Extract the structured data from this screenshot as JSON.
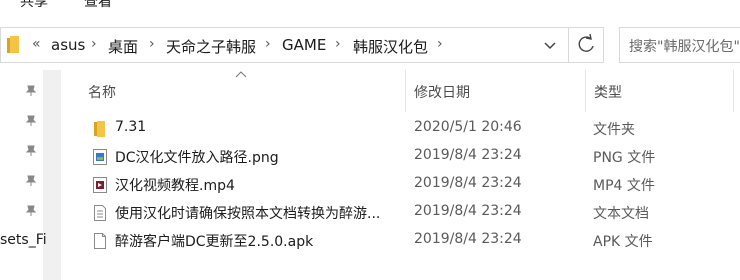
{
  "ribbon": {
    "tabs": [
      "共享",
      "查看"
    ]
  },
  "address": {
    "overflow": "«",
    "crumbs": [
      "asus",
      "桌面",
      "天命之子韩服",
      "GAME",
      "韩服汉化包"
    ],
    "separator": "›"
  },
  "search": {
    "placeholder": "搜索\"韩服汉化包\""
  },
  "navpane": {
    "fragment": "sets_Fi"
  },
  "columns": {
    "name": "名称",
    "date": "修改日期",
    "type": "类型"
  },
  "files": [
    {
      "name": "7.31",
      "date": "2020/5/1 20:46",
      "type": "文件夹",
      "icon": "folder-icon"
    },
    {
      "name": "DC汉化文件放入路径.png",
      "date": "2019/8/4 23:24",
      "type": "PNG 文件",
      "icon": "png-icon"
    },
    {
      "name": "汉化视频教程.mp4",
      "date": "2019/8/4 23:24",
      "type": "MP4 文件",
      "icon": "video-icon"
    },
    {
      "name": "使用汉化时请确保按照本文档转换为醉游...",
      "date": "2019/8/4 23:24",
      "type": "文本文档",
      "icon": "text-doc-icon"
    },
    {
      "name": "醉游客户端DC更新至2.5.0.apk",
      "date": "2019/8/4 23:24",
      "type": "APK 文件",
      "icon": "apk-icon"
    }
  ]
}
